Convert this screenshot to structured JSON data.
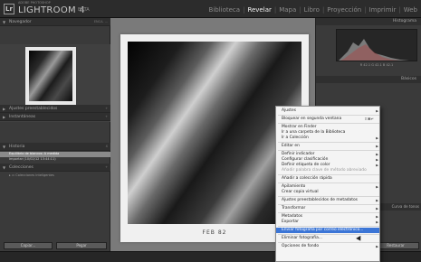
{
  "app": {
    "company": "ADOBE PHOTOSHOP",
    "title": "LIGHTROOM 4",
    "beta": "BETA"
  },
  "modules": [
    {
      "label": "Biblioteca",
      "active": false
    },
    {
      "label": "Revelar",
      "active": true
    },
    {
      "label": "Mapa",
      "active": false
    },
    {
      "label": "Libro",
      "active": false
    },
    {
      "label": "Proyección",
      "active": false
    },
    {
      "label": "Imprimir",
      "active": false
    },
    {
      "label": "Web",
      "active": false
    }
  ],
  "left_panel": {
    "navigator": {
      "label": "Navegador",
      "zoom_options": "ENCA.  ..."
    },
    "presets": {
      "label": "Ajustes preestablecidos"
    },
    "snapshots": {
      "label": "Instantáneas"
    },
    "history": {
      "label": "Historia",
      "items": [
        "Equilibrio de blancos: A medida",
        "Importar (10/02/12 13:44:11)"
      ]
    },
    "collections": {
      "label": "Colecciones",
      "item": "Colecciones inteligentes"
    },
    "copy_button": "Copiar...",
    "paste_button": "Pegar"
  },
  "photo": {
    "caption": "FEB   82"
  },
  "right_panel": {
    "histogram_label": "Histograma",
    "histogram_stats": "R  42.1   G  42.1   B  42.1",
    "basic_label": "Básicos",
    "tone_label": "Curva de tonos",
    "restore_button": "Restaurar"
  },
  "context_menu": {
    "items": [
      {
        "label": "Ajustes",
        "submenu": true
      },
      {
        "sep": true
      },
      {
        "label": "Bloquear en segunda ventana",
        "shortcut": "⇧⌘↵"
      },
      {
        "sep": true
      },
      {
        "label": "Mostrar en Finder"
      },
      {
        "label": "Ir a una carpeta de la Biblioteca"
      },
      {
        "label": "Ir a Colección",
        "submenu": true
      },
      {
        "sep": true
      },
      {
        "label": "Editar en",
        "submenu": true
      },
      {
        "sep": true
      },
      {
        "label": "Definir indicador",
        "submenu": true
      },
      {
        "label": "Configurar clasificación",
        "submenu": true
      },
      {
        "label": "Definir etiqueta de color",
        "submenu": true
      },
      {
        "label": "Añadir palabra clave de método abreviado",
        "disabled": true
      },
      {
        "sep": true
      },
      {
        "label": "Añadir a colección rápida"
      },
      {
        "sep": true
      },
      {
        "label": "Apilamiento",
        "submenu": true
      },
      {
        "label": "Crear copia virtual"
      },
      {
        "sep": true
      },
      {
        "label": "Ajustes preestablecidos de metadatos",
        "submenu": true
      },
      {
        "sep": true
      },
      {
        "label": "Transformar",
        "submenu": true
      },
      {
        "sep": true
      },
      {
        "label": "Metadatos",
        "submenu": true
      },
      {
        "label": "Exportar",
        "submenu": true
      },
      {
        "sep": true
      },
      {
        "label": "Enviar fotografía por correo electrónico...",
        "highlighted": true
      },
      {
        "sep": true
      },
      {
        "label": "Eliminar fotografía..."
      },
      {
        "sep": true
      },
      {
        "label": "Opciones de fondo",
        "submenu": true
      }
    ]
  }
}
